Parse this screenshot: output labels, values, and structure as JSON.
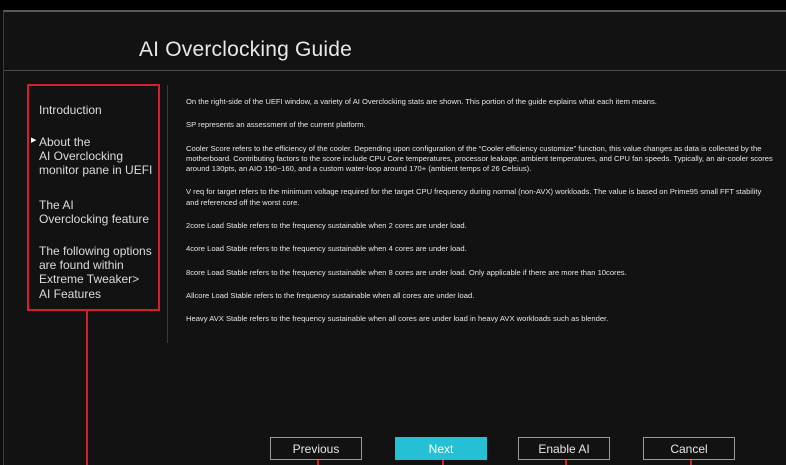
{
  "dialog": {
    "title": "AI Overclocking Guide"
  },
  "nav": {
    "items": [
      {
        "label": "Introduction"
      },
      {
        "label": "About the\nAI Overclocking\nmonitor pane in UEFI"
      },
      {
        "label": "The AI\nOverclocking feature"
      },
      {
        "label": "The following options\nare found within\nExtreme Tweaker>\nAI Features"
      }
    ],
    "current_marker_icon": "triangle-right-icon"
  },
  "content": {
    "paragraphs": [
      "On the right-side of the UEFI window, a variety of AI Overclocking stats are shown. This portion of the guide explains what each item means.",
      "SP represents an assessment of the current platform.",
      "Cooler Score refers to the efficiency of the cooler. Depending upon configuration of the “Cooler efficiency customize” function, this value changes as data is collected by the motherboard. Contributing factors to the score include CPU Core temperatures, processor leakage, ambient temperatures, and CPU fan speeds. Typically, an air-cooler scores around 130pts, an AIO 150~160, and a custom water-loop around 170+ (ambient temps of 26 Celsius).",
      "V req for target refers to the minimum voltage required for the target CPU frequency during normal (non-AVX) workloads. The value is based on Prime95 small FFT stability and referenced off the worst core.",
      "2core Load Stable refers to the frequency sustainable when 2 cores are under load.",
      "4core Load Stable refers to the frequency sustainable when 4 cores are under load.",
      "8core Load Stable refers to the frequency sustainable when 8 cores are under load. Only applicable if there are more than 10cores.",
      "Allcore Load Stable refers to the frequency sustainable when all cores are under load.",
      "Heavy AVX Stable refers to the frequency sustainable when all cores are under load in heavy AVX workloads such as blender."
    ]
  },
  "buttons": {
    "previous": "Previous",
    "next": "Next",
    "enable_ai": "Enable AI",
    "cancel": "Cancel"
  },
  "colors": {
    "accent": "#25c0d5",
    "callout": "#d2202e",
    "background": "#121212"
  }
}
